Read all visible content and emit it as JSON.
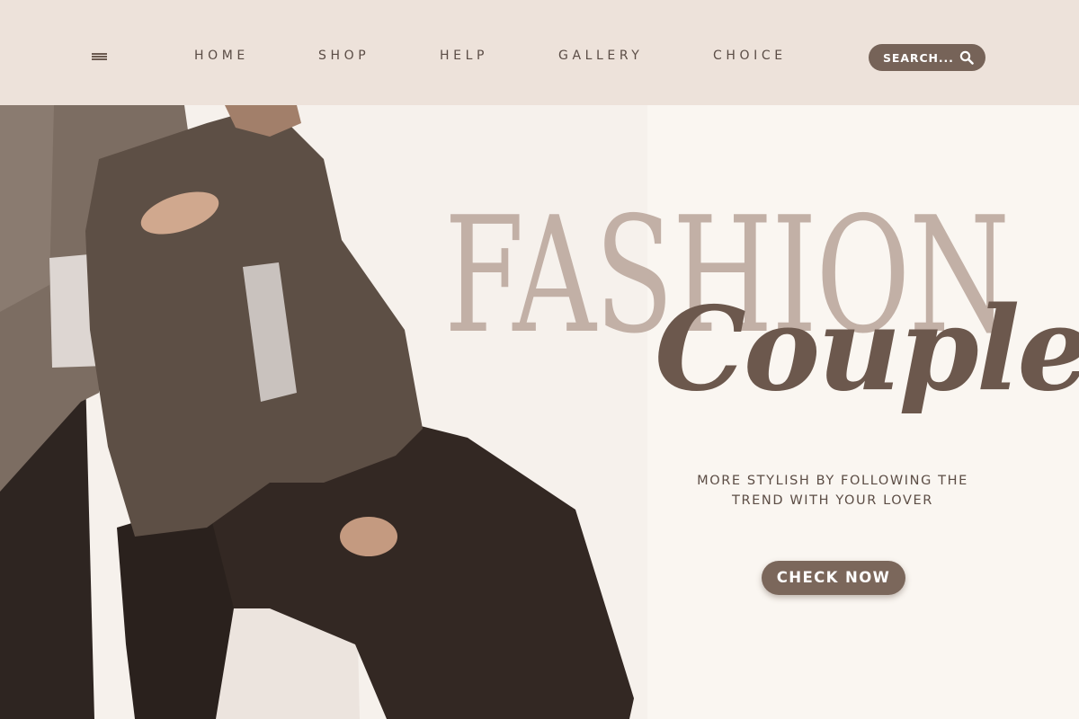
{
  "nav": {
    "menu_icon": "hamburger-menu-icon",
    "items": [
      {
        "label": "HOME"
      },
      {
        "label": "SHOP"
      },
      {
        "label": "HELP"
      },
      {
        "label": "GALLERY"
      },
      {
        "label": "CHOICE"
      }
    ]
  },
  "search": {
    "placeholder": "SEARCH...",
    "icon": "search-icon"
  },
  "hero": {
    "title_line1": "FASHION",
    "title_line2": "Couple",
    "tagline": "MORE STYLISH BY FOLLOWING THE TREND WITH YOUR LOVER",
    "cta_label": "CHECK NOW"
  },
  "colors": {
    "header_bg": "#ede2da",
    "page_bg": "#faf6f1",
    "accent": "#766358",
    "title_light": "#c2b0a6",
    "title_dark": "#6c584d",
    "text": "#5a4c45"
  }
}
